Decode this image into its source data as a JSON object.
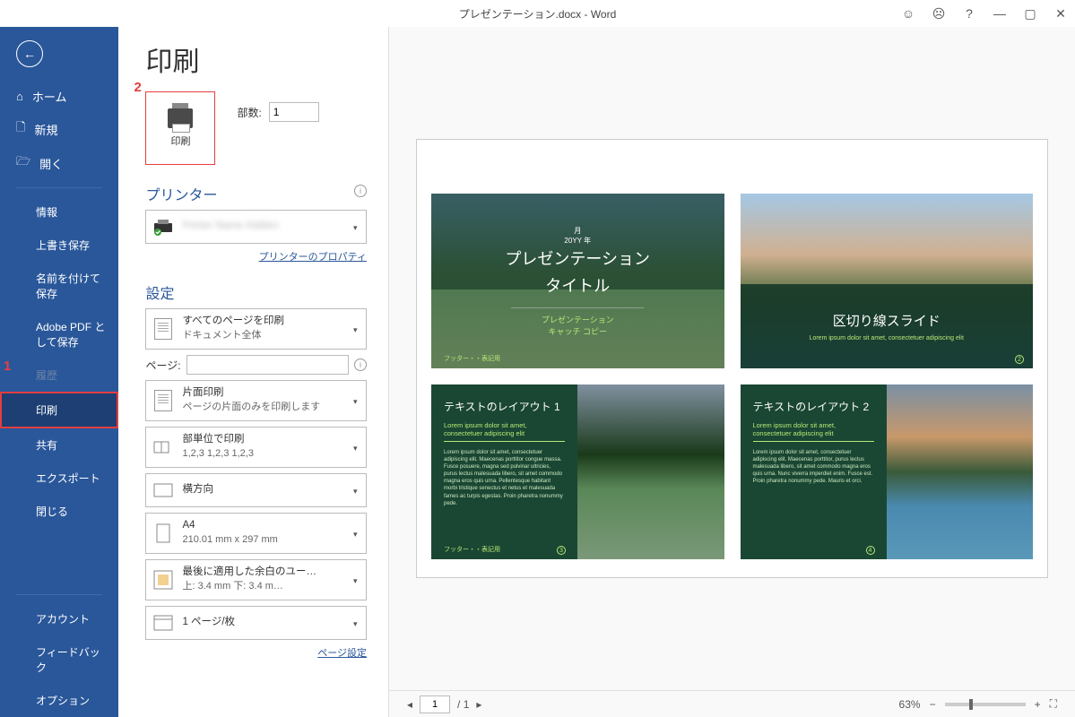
{
  "titlebar": {
    "title": "プレゼンテーション.docx - Word"
  },
  "sidebar": {
    "home": "ホーム",
    "new": "新規",
    "open": "開く",
    "items": [
      "情報",
      "上書き保存",
      "名前を付けて保存",
      "Adobe PDF として保存",
      "履歴",
      "印刷",
      "共有",
      "エクスポート",
      "閉じる"
    ],
    "bottom": [
      "アカウント",
      "フィードバック",
      "オプション"
    ]
  },
  "annotations": {
    "a1": "1",
    "a2": "2"
  },
  "print": {
    "page_title": "印刷",
    "btn_label": "印刷",
    "copies_label": "部数:",
    "copies_value": "1",
    "printer_section": "プリンター",
    "printer_props_link": "プリンターのプロパティ",
    "settings_section": "設定",
    "dd_all_pages": "すべてのページを印刷",
    "dd_all_pages_sub": "ドキュメント全体",
    "pages_label": "ページ:",
    "dd_oneside": "片面印刷",
    "dd_oneside_sub": "ページの片面のみを印刷します",
    "dd_collate": "部単位で印刷",
    "dd_collate_sub": "1,2,3    1,2,3    1,2,3",
    "dd_orient": "横方向",
    "dd_paper": "A4",
    "dd_paper_sub": "210.01 mm x 297 mm",
    "dd_margins": "最後に適用した余白のユー…",
    "dd_margins_sub": "上: 3.4 mm 下: 3.4 m…",
    "dd_perpage": "1 ページ/枚",
    "page_setup_link": "ページ設定"
  },
  "slides": {
    "s1_date1": "月",
    "s1_date2": "20YY 年",
    "s1_title1": "プレゼンテーション",
    "s1_title2": "タイトル",
    "s1_sub1": "プレゼンテーション",
    "s1_sub2": "キャッチ コピー",
    "s1_footer": "フッター・・表記用",
    "s2_title": "区切り線スライド",
    "s2_sub": "Lorem ipsum dolor sit amet, consectetuer adipiscing elit",
    "s3_title": "テキストのレイアウト 1",
    "s3_sub": "Lorem ipsum dolor sit amet, consectetuer adipiscing elit",
    "s3_body": "Lorem ipsum dolor sit amet, consectetuer adipiscing elit. Maecenas porttitor congue massa. Fusce posuere, magna sed pulvinar ultricies, purus lectus malesuada libero, sit amet commodo magna eros quis urna.\nPellentesque habitant morbi tristique senectus et netus et malesuada fames ac turpis egestas. Proin pharetra nonummy pede.",
    "s3_footer": "フッター・・表記用",
    "s4_title": "テキストのレイアウト 2",
    "s4_sub": "Lorem ipsum dolor sit amet, consectetuer adipiscing elit",
    "s4_body": "Lorem ipsum dolor sit amet, consectetuer adipiscing elit. Maecenas porttitor, purus lectus malesuada libero, sit amet commodo magna eros quis urna.\nNunc viverra imperdiet enim. Fusce est.\nProin pharetra nonummy pede. Mauris et orci."
  },
  "footer": {
    "page_current": "1",
    "page_total": "/ 1",
    "zoom": "63%"
  }
}
